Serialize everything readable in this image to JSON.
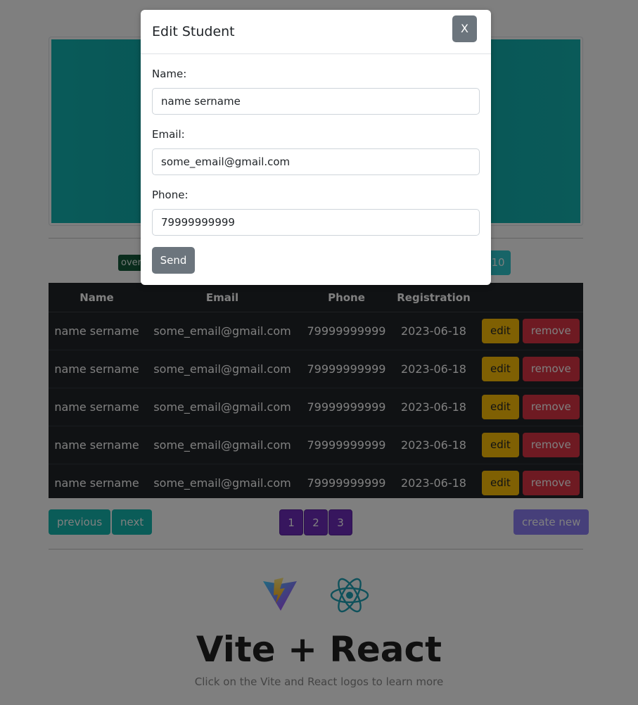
{
  "background": {
    "overall_badge": "overall",
    "page_size_button": "10",
    "table": {
      "headers": [
        "Name",
        "Email",
        "Phone",
        "Registration"
      ],
      "rows": [
        {
          "name": "name sername",
          "email": "some_email@gmail.com",
          "phone": "79999999999",
          "registration": "2023-06-18"
        },
        {
          "name": "name sername",
          "email": "some_email@gmail.com",
          "phone": "79999999999",
          "registration": "2023-06-18"
        },
        {
          "name": "name sername",
          "email": "some_email@gmail.com",
          "phone": "79999999999",
          "registration": "2023-06-18"
        },
        {
          "name": "name sername",
          "email": "some_email@gmail.com",
          "phone": "79999999999",
          "registration": "2023-06-18"
        },
        {
          "name": "name sername",
          "email": "some_email@gmail.com",
          "phone": "79999999999",
          "registration": "2023-06-18"
        }
      ],
      "edit_label": "edit",
      "remove_label": "remove"
    },
    "pagination": {
      "previous_label": "previous",
      "next_label": "next",
      "pages": [
        "1",
        "2",
        "3"
      ],
      "create_label": "create new"
    },
    "footer": {
      "title": "Vite + React",
      "subtitle": "Click on the Vite and React logos to learn more"
    }
  },
  "modal": {
    "title": "Edit Student",
    "close_label": "X",
    "fields": {
      "name_label": "Name:",
      "name_value": "name sername",
      "email_label": "Email:",
      "email_value": "some_email@gmail.com",
      "phone_label": "Phone:",
      "phone_value": "79999999999"
    },
    "send_label": "Send"
  },
  "colors": {
    "overlay": "rgba(0,0,0,0.5)",
    "accent_teal": "#14b8b0",
    "page_purple": "#6f2dbd",
    "edit_yellow": "#ffc107",
    "remove_red": "#dc3545",
    "secondary_gray": "#6c757d"
  },
  "icons": [
    "vite-logo-icon",
    "react-logo-icon"
  ]
}
